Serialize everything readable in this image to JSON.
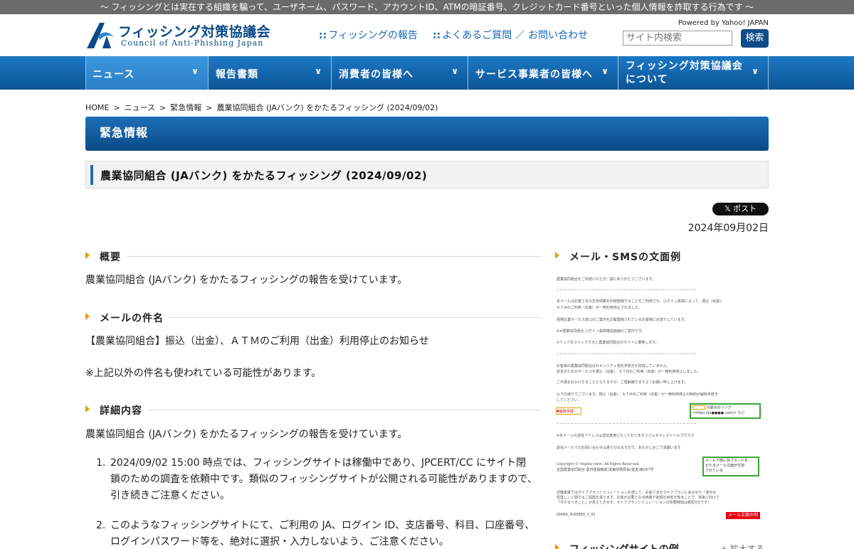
{
  "topbar": {
    "text": "〜 フィッシングとは実在する組織を騙って、ユーザネーム、パスワード、アカウントID、ATMの暗証番号、クレジットカード番号といった個人情報を詐取する行為です 〜"
  },
  "header": {
    "logo_title": "フィッシング対策協議会",
    "logo_sub": "Council of Anti-Phishing Japan",
    "link_report": "フィッシングの報告",
    "link_faq": "よくあるご質問 ／ お問い合わせ",
    "link_dots": "::",
    "powered": "Powered by Yahoo! JAPAN",
    "search_placeholder": "サイト内検索",
    "search_button": "検索"
  },
  "nav": {
    "items": [
      {
        "label": "ニュース"
      },
      {
        "label": "報告書類"
      },
      {
        "label": "消費者の皆様へ"
      },
      {
        "label": "サービス事業者の皆様へ"
      },
      {
        "label_line1": "フィッシング対策協議会",
        "label_line2": "について"
      }
    ],
    "chevron": "∨"
  },
  "breadcrumb": {
    "items": [
      "HOME",
      "ニュース",
      "緊急情報",
      "農業協同組合 (JAバンク) をかたるフィッシング (2024/09/02)"
    ],
    "sep": ">"
  },
  "banner": {
    "title": "緊急情報"
  },
  "page": {
    "title": "農業協同組合 (JAバンク) をかたるフィッシング (2024/09/02)",
    "xpost": "𝕏 ポスト",
    "date": "2024年09月02日"
  },
  "sections": {
    "overview": {
      "heading": "概要",
      "text": "農業協同組合 (JAバンク) をかたるフィッシングの報告を受けています。"
    },
    "subject": {
      "heading": "メールの件名",
      "text": "【農業協同組合】振込（出金）、ＡＴＭのご利用（出金）利用停止のお知らせ",
      "note": "※上記以外の件名も使われている可能性があります。"
    },
    "details": {
      "heading": "詳細内容",
      "text": "農業協同組合 (JAバンク) をかたるフィッシングの報告を受けています。",
      "list": [
        {
          "num": "1.",
          "line1": "2024/09/02 15:00 時点では、フィッシングサイトは稼働中であり、JPCERT/CC にサイト閉",
          "line2": "鎖のための調査を依頼中です。類似のフィッシングサイトが公開される可能性がありますので、",
          "line3": "引き続きご注意ください。"
        },
        {
          "num": "2.",
          "line1": "このようなフィッシングサイトにて、ご利用の JA、ログイン ID、支店番号、科目、口座番号、",
          "line2": "ログインパスワード等を、絶対に選択・入力しないよう、ご注意ください。"
        }
      ]
    }
  },
  "sidebar": {
    "mail_heading": "メール・SMSの文面例",
    "mail_lines": [
      "農業協同組合をご利用いただき、誠にありがとうございます。",
      "本メールはお客さまの生体情報を利用登録することをご利用され、ログイン異常によって、振込（出金）、",
      "ＡＴＭのご利用（出金）が一時利用停止されました。",
      "現場企業サービス窓口のご案内を記載登録されているお客様にお送りしています。",
      "※※農業協同組合 ログイン異常確認画面のご案内です。",
      "※リンクをクリックすると農業協同組合のサイトに遷移します。",
      "お客様の農業協同組合はセキュリティ強化手続きが完成していません。",
      "安全のためのサービスを振込（出金）、ＡＴＭのご利用（出金）が一時利用停止しました。",
      "ご不便をおかけすることとなりますが、ご理解賜りますようお願い申し上げます。",
      "以下の通りでございます。振込（出金）、ＡＴＭのご利用（出金）が一時利用停止の制約が解除手続き",
      "してください。",
      "▼解除手続",
      "※本メールの送信アドレスは送信専用となっておりますうさんダイレクトヘルプデスク",
      "返信メールでのお問い合わせは承りかねますので、あらかじめご了承願います",
      "Copyright © niigata-rokin. All Rights Reserved.",
      "全国農業協同組合 農林金融機関 関東財務局長(登金)第267号",
      "労働金庫ではライフプランシミュレーションを通じて、お客さまのライフプランにあわせた「家計の",
      "見直し」に関するご提案を承ります。お金が必要となる時期や金額の目安を知ることで、将来に向けて",
      "「今やるべきこと」が見えてきます。ライフプランシミュレーションの所要時間は最短3分です！",
      "[RAND_NUMBER_5_8]"
    ],
    "callout1_l1": "の部分のリンク",
    "callout1_l2": "<https://ja●●●●.com/> など",
    "callout2_l1": "メール下部に別ブランドを",
    "callout2_l2": "かたるメール文面が付加",
    "callout2_l3": "されている",
    "red_tag": "メール文面の例",
    "site_heading": "フィッシングサイトの例",
    "zoom_label": "+ 拡大する"
  }
}
